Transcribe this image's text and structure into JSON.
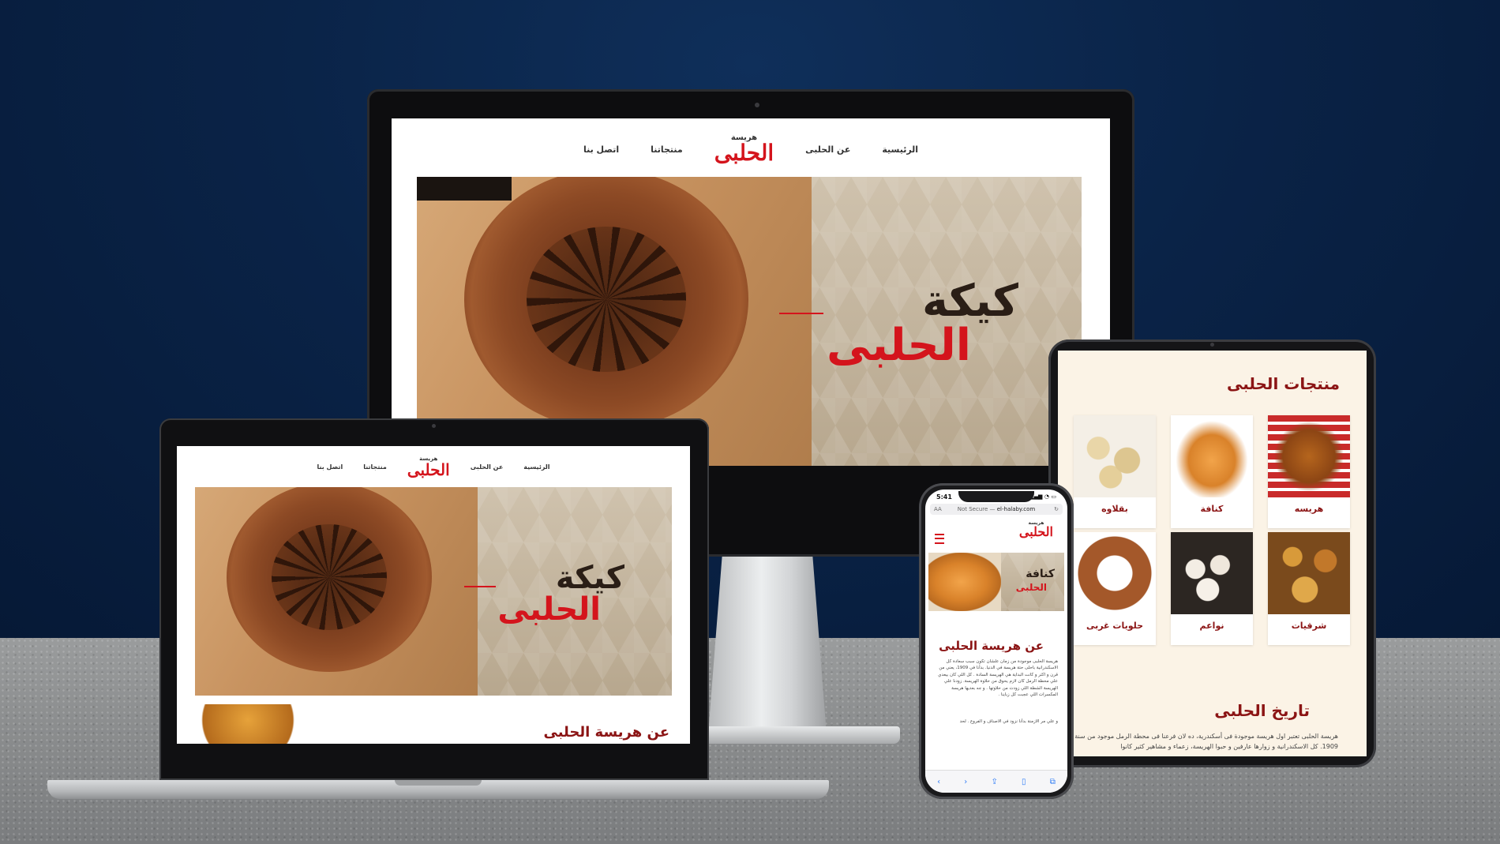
{
  "site": {
    "logo_small": "هريسة",
    "logo_big": "الحلبى",
    "nav": {
      "home": "الرئيسية",
      "about": "عن الحلبى",
      "products": "منتجاتنا",
      "contact": "اتصل بنا"
    },
    "hero": {
      "line1": "كيكة",
      "line2": "الحلبى"
    }
  },
  "laptop": {
    "section_title": "عن هريسة الحلبى"
  },
  "tablet": {
    "products_title": "منتجات الحلبى",
    "products": [
      {
        "label": "هريسه"
      },
      {
        "label": "كنافة"
      },
      {
        "label": "بقلاوه"
      },
      {
        "label": "شرقيات"
      },
      {
        "label": "نواعم"
      },
      {
        "label": "حلويات غربى"
      }
    ],
    "history_title": "تاريخ الحلبى",
    "history_text": "هريسة الحلبى تعتبر اول هريسة موجودة فى أسكندرية، ده لان فرعنا فى محطة الرمل موجود من سنة 1909. كل الاسكندرانية و زوارها عارفين و حبوا الهريسة، زعماء و مشاهير كثير كانوا"
  },
  "phone": {
    "time": "5:41",
    "url_prefix": "Not Secure —",
    "url": "el-halaby.com",
    "text_size": "AA",
    "hero_line1": "كنافة",
    "hero_line2": "الحلبى",
    "about_title": "عن هريسة الحلبى",
    "about_text": "هريسة الحلبى موجودة من زمان علشان تكون سبب سعادة كل الاسكندرانية باحلى حتة هريسة في الدنيا. بدأنا في 1909، يعني من قرن و اكثر و كانت البداية هي الهريسة السادة . كل اللي كان بيعدي علي محطة الرمل كان لازم يحوق من حلاوة الهريسة. زودنا علي الهريسة الشطة اللي زودت من حلاوتها . و جه بعديها هريسة المكسرات اللي عجبت كل زباينا .",
    "about_text2": "و علي مر الازمنة بدأنا نزود في الاصناف و الفروع . لحد"
  }
}
